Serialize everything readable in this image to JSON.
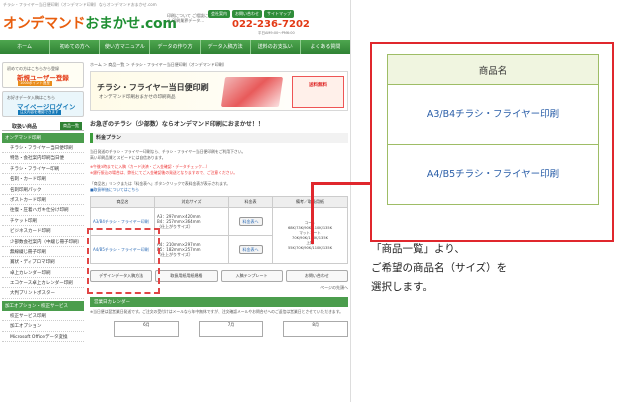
{
  "site": {
    "topline": "チラシ・フライヤー当日便印刷（オンデマンド印刷）ならオンデマンドおまかせ.com",
    "logo_part1": "オンデマンド",
    "logo_part2": "おまかせ.com",
    "tagline": "印刷について ご相談にもお答え 印刷業界データ…",
    "top_links": [
      "会社案内",
      "お問い合わせ",
      "サイトマップ"
    ],
    "phone": "022-236-7202",
    "phone_hours": "平日AM9:00～PM6:00",
    "gnav": [
      "ホーム",
      "初めての方へ",
      "使い方マニュアル",
      "データの作り方",
      "データ入稿方法",
      "送料のお支払い",
      "よくある質問"
    ],
    "sidebar": {
      "banner1_small": "初めての方はこちらから登録",
      "banner1_big": "新規ユーザー登録",
      "banner1_sub": "1000ポイント進呈",
      "banner2_small": "お好きデータ入稿はこちら",
      "banner2_big": "マイページログイン",
      "banner2_sub": "注文内容を確認できます",
      "head": "取扱い商品",
      "head_btn": "商品一覧",
      "cat1": "オンデマンド印刷",
      "items": [
        "チラシ・フライヤー当日便印刷",
        "特急・会社案内印刷当日便",
        "チラシ・フライヤー印刷",
        "名刺・カード印刷",
        "名刺印刷パック",
        "ポストカード印刷",
        "往復・圧着ハガキ仕分け印刷",
        "チケット印刷",
        "ビジネスカード印刷",
        "少部数会社案内（中綴じ冊子印刷）",
        "無線綴じ冊子印刷",
        "賞状・ディプロマ印刷",
        "卓上カレンダー印刷",
        "エコケース卓上カレンダー印刷",
        "大判プリントポスター"
      ],
      "cat2": "加工オプション・校正サービス",
      "items2": [
        "校正サービス印刷",
        "加工オプション",
        "Microsoft Officeデータ変換"
      ]
    },
    "main": {
      "breadcrumb": "ホーム ＞ 商品一覧 ＞ チラシ・フライヤー当日便印刷（オンデマンド印刷）",
      "hero_title": "チラシ・フライヤー当日便印刷",
      "hero_sub": "オンデマンド印刷おまかせの印刷商品",
      "hero_ship": "送料無料",
      "lead": "お急ぎのチラシ（少部数）ならオンデマンド印刷におまかせ！！",
      "section": "料金プラン",
      "para1": "当日発送のチラシ・フライヤー印刷なら、チラシ・フライヤー当日便印刷をご利用下さい。",
      "para2": "高い印刷品質とスピードには自信あります。",
      "para_red1": "※午後3時までに入稿（カード決済・ご入金確認・データチェック…）",
      "para_red2": "※銀行振込の場合は、弊社にてご入金確認後の発送となりますので、ご注意ください。",
      "para3": "「商品名」リンクまたは「料金表へ」ボタンクリックで表料金表が表示されます。",
      "para4": "■取扱単価についてはこちら",
      "table_headers": [
        "商品名",
        "対応サイズ",
        "料金表",
        "備考／取扱用紙"
      ],
      "rows": [
        {
          "name": "A3/B4チラシ・フライヤー印刷",
          "size": "A3：297mm×420mm\nB4：257mm×364mm\n（仕上がりサイズ）",
          "btn": "料金表へ",
          "note": "コート\n68K/73K/90K/110K/135K\nマットコート\n70K/90K/110K/135K\n上質\n55K/70K/90K/110K/135K"
        },
        {
          "name": "A4/B5チラシ・フライヤー印刷",
          "size": "A4：210mm×297mm\nB5：182mm×257mm\n（仕上がりサイズ）",
          "btn": "料金表へ",
          "note": ""
        }
      ],
      "buttons": [
        "デザインデータ入稿方法",
        "取扱用紙用紙規格",
        "入稿テンプレート",
        "お問い合わせ"
      ],
      "pagetop": "ページの先頭へ",
      "cal_head": "営業日カレンダー",
      "cal_note": "※当日便は翌営業日発送です。ご注文の受付けはメールなら年中無休ですが、注文確認メールやお問合せへのご返信は営業日とさせていただきます。",
      "cal_months": [
        "6月",
        "7月",
        "8月"
      ]
    }
  },
  "callout": {
    "header": "商品名",
    "items": [
      "A3/B4チラシ・フライヤー印刷",
      "A4/B5チラシ・フライヤー印刷"
    ]
  },
  "instruction": "「商品一覧」より、\nご希望の商品名（サイズ）を\n選択します。"
}
